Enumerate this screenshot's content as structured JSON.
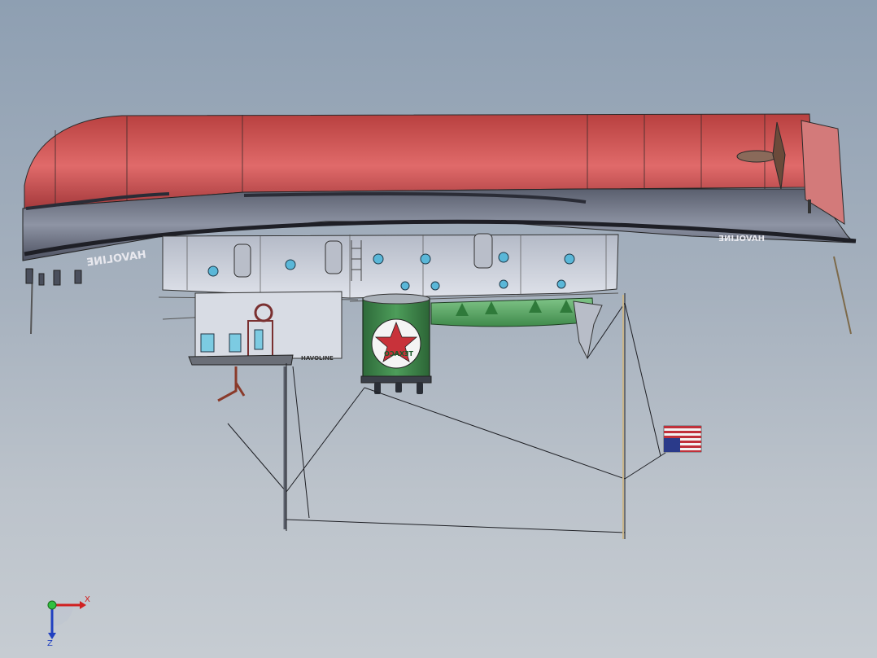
{
  "viewport": {
    "background_top": "#8e9fb2",
    "background_bottom": "#c6ccd2"
  },
  "model": {
    "hull_lettering_port": "HAVOLINE",
    "hull_lettering_stern": "HAVOLINE",
    "deckhouse_lettering": "HAVOLINE",
    "tank_emblem_text": "TEXACO",
    "colors": {
      "hull_red": "#c8494a",
      "hull_band": "#565b6b",
      "deck_gray": "#c5cad6",
      "tank_green": "#3d8a4c",
      "float_green": "#5fae6a",
      "emblem_red": "#c8323a",
      "flag_blue": "#2a3a8a",
      "flag_red": "#c0303a"
    }
  },
  "triad": {
    "x_label": "X",
    "z_label": "Z",
    "icon": "coordinate-triad-icon"
  }
}
